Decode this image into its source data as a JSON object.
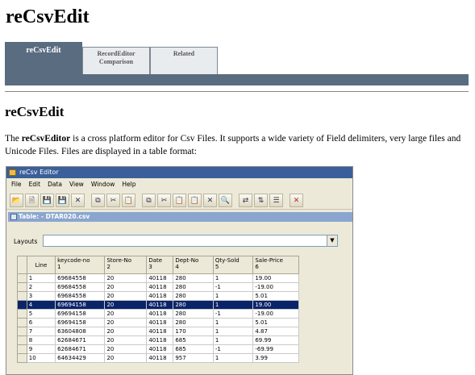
{
  "page": {
    "title": "reCsvEdit",
    "tabs": [
      {
        "label": "reCsvEdit"
      },
      {
        "label": "RecordEditor\nComparison"
      },
      {
        "label": "Related"
      }
    ],
    "section_title": "reCsvEdit",
    "paragraph_bold": "reCsvEditor",
    "paragraph_pre": "The ",
    "paragraph_post": " is a cross platform editor for Csv Files. It supports a wide variety of Field delimiters, very large files and Unicode Files. Files are displayed in a table format:"
  },
  "app": {
    "window_title": "reCsv Editor",
    "menu": [
      "File",
      "Edit",
      "Data",
      "View",
      "Window",
      "Help"
    ],
    "table_title": "Table: - DTAR020.csv",
    "layouts_label": "Layouts",
    "columns": [
      {
        "name": "Line",
        "num": ""
      },
      {
        "name": "keycode-no",
        "num": "1"
      },
      {
        "name": "Store-No",
        "num": "2"
      },
      {
        "name": "Date",
        "num": "3"
      },
      {
        "name": "Dept-No",
        "num": "4"
      },
      {
        "name": "Qty-Sold",
        "num": "5"
      },
      {
        "name": "Sale-Price",
        "num": "6"
      }
    ],
    "rows": [
      [
        "1",
        "69684558",
        "20",
        "40118",
        "280",
        "1",
        "19.00"
      ],
      [
        "2",
        "69684558",
        "20",
        "40118",
        "280",
        "-1",
        "-19.00"
      ],
      [
        "3",
        "69684558",
        "20",
        "40118",
        "280",
        "1",
        "5.01"
      ],
      [
        "4",
        "69694158",
        "20",
        "40118",
        "280",
        "1",
        "19.00"
      ],
      [
        "5",
        "69694158",
        "20",
        "40118",
        "280",
        "-1",
        "-19.00"
      ],
      [
        "6",
        "69694158",
        "20",
        "40118",
        "280",
        "1",
        "5.01"
      ],
      [
        "7",
        "63604808",
        "20",
        "40118",
        "170",
        "1",
        "4.87"
      ],
      [
        "8",
        "62684671",
        "20",
        "40118",
        "685",
        "1",
        "69.99"
      ],
      [
        "9",
        "62684671",
        "20",
        "40118",
        "685",
        "-1",
        "-69.99"
      ],
      [
        "10",
        "64634429",
        "20",
        "40118",
        "957",
        "1",
        "3.99"
      ]
    ],
    "selected_row": 3
  }
}
